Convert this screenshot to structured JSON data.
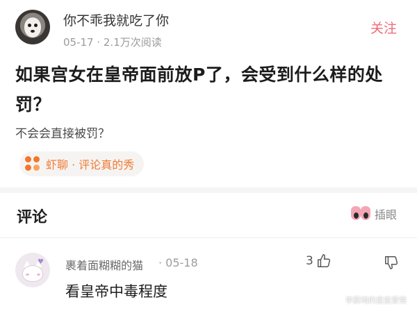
{
  "post": {
    "author": "你不乖我就吃了你",
    "meta": "05-17 · 2.1万次阅读",
    "follow_label": "关注",
    "title": "如果宫女在皇帝面前放P了，会受到什么样的处罚？",
    "subtext": "不会会直接被罚？",
    "topic_label": "虾聊 · 评论真的秀"
  },
  "comments_section": {
    "title": "评论",
    "insert_eye_label": "插眼"
  },
  "comments": [
    {
      "author": "裹着面糊糊的猫",
      "date": "· 05-18",
      "likes": "3",
      "text": "看皇帝中毒程度"
    }
  ],
  "watermark": "李蔚琦的星座爱情",
  "colors": {
    "follow": "#ef6a77",
    "topic": "#f07a34",
    "muted": "#9b9b9b"
  },
  "icons": {
    "topic": "topic-dots-icon",
    "insert_eye": "eyes-icon",
    "like": "thumbs-up-icon",
    "dislike": "thumbs-down-icon"
  }
}
